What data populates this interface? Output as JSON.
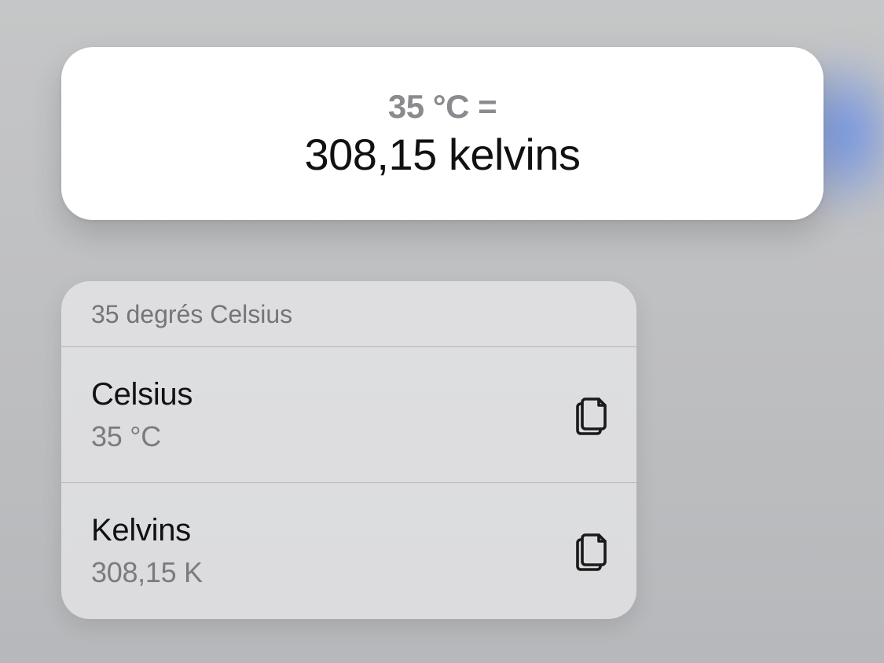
{
  "result": {
    "from_label": "35 °C =",
    "to_label": "308,15 kelvins"
  },
  "list": {
    "header": "35 degrés Celsius",
    "rows": [
      {
        "title": "Celsius",
        "value": "35 °C"
      },
      {
        "title": "Kelvins",
        "value": "308,15 K"
      }
    ]
  }
}
